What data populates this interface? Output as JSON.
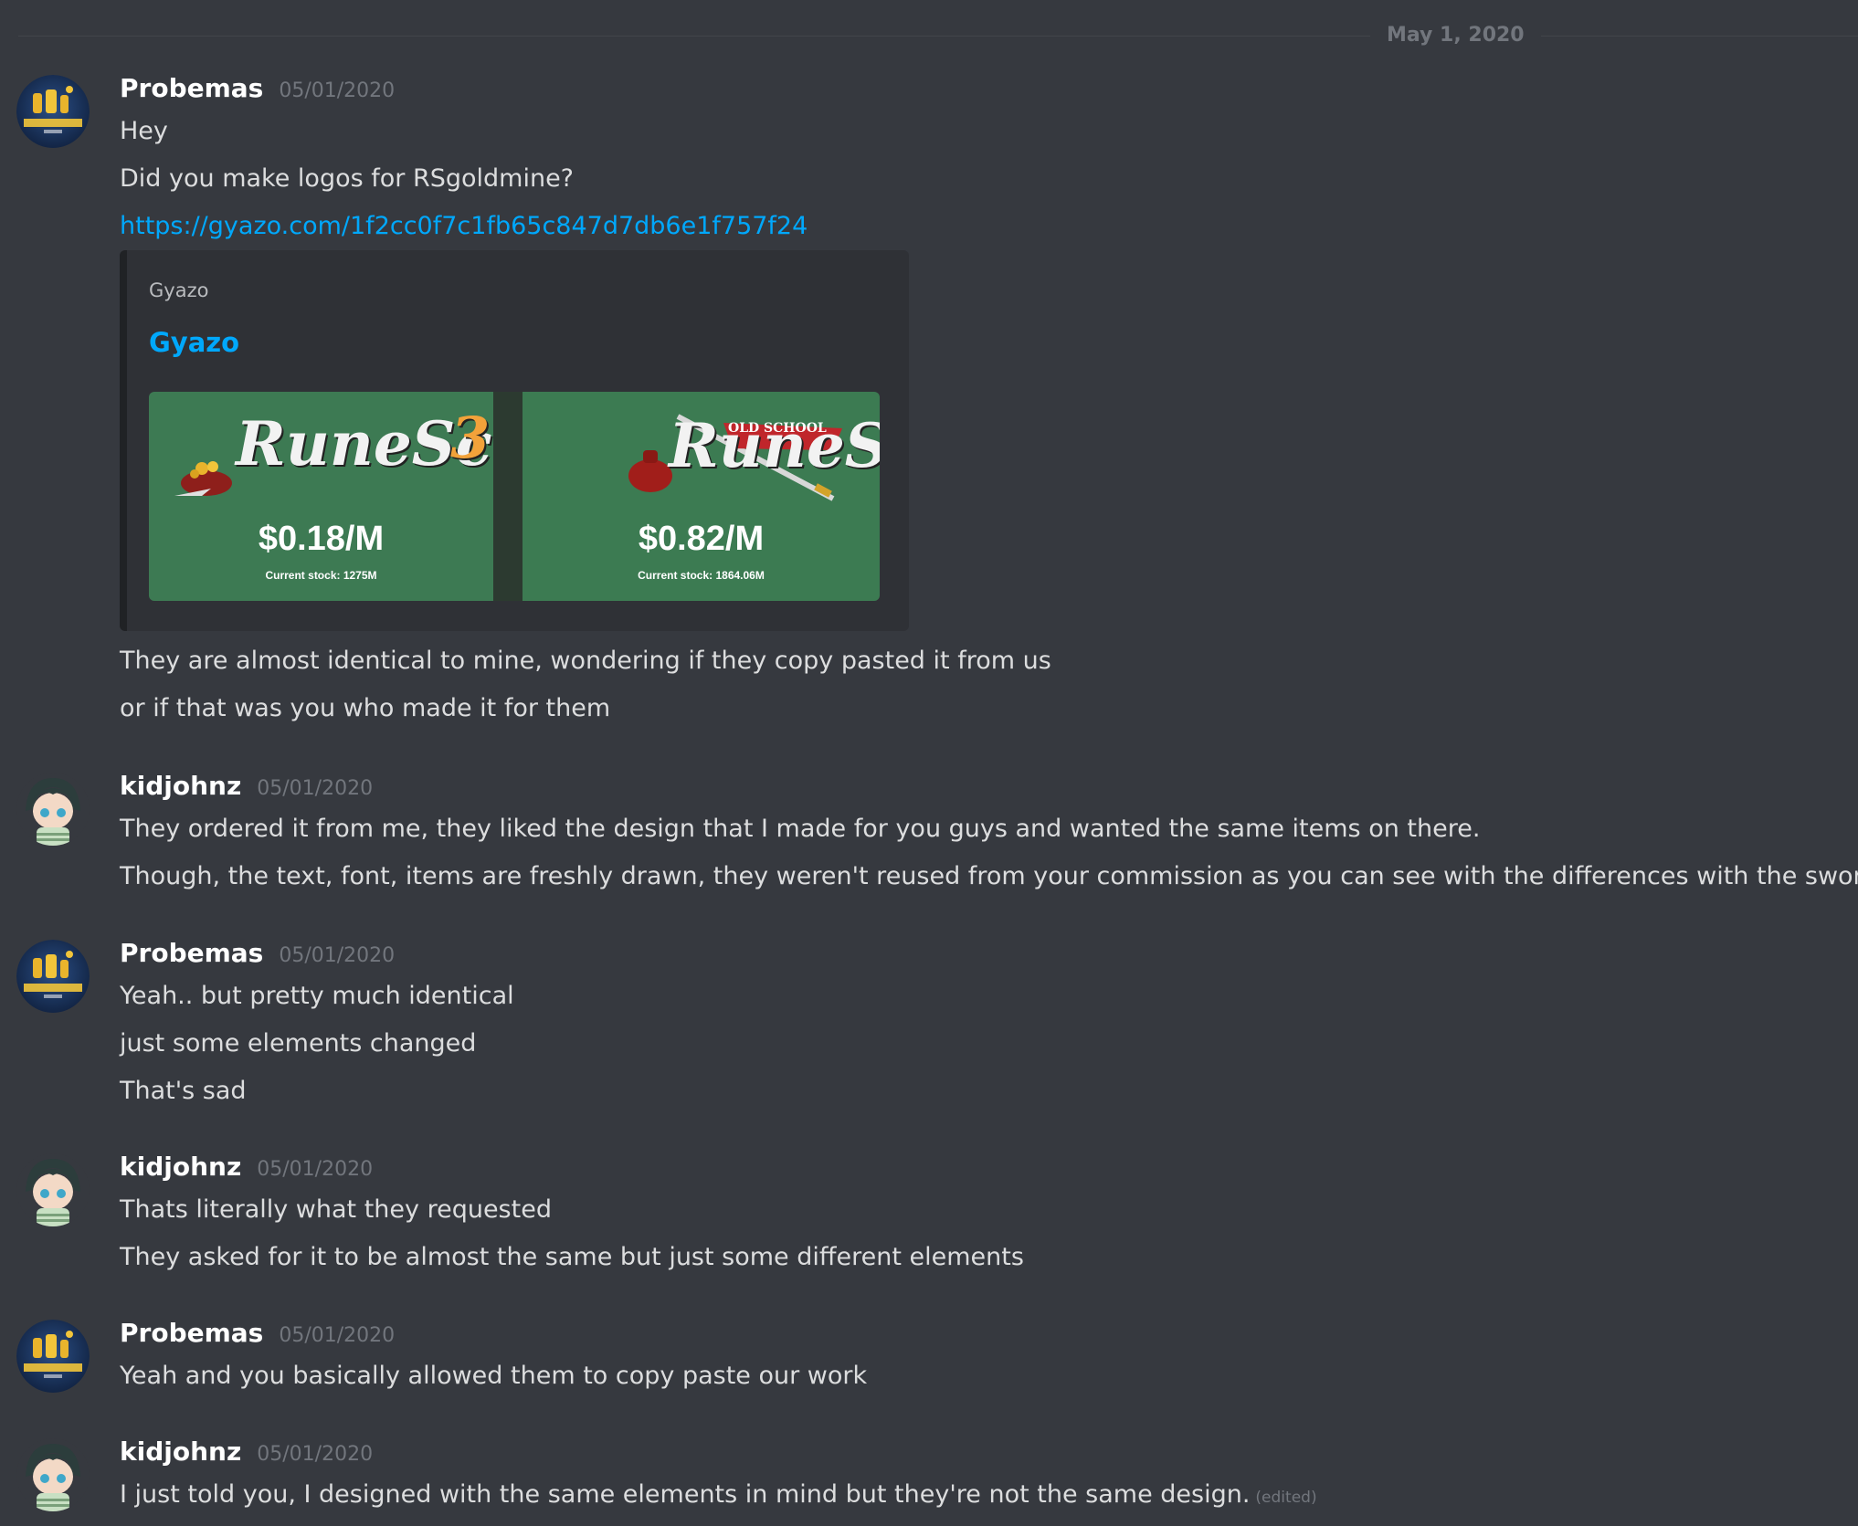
{
  "divider": {
    "date": "May 1, 2020"
  },
  "users": {
    "probemas": {
      "name": "Probemas",
      "avatar_icon": "probemas-logo-avatar",
      "avatar_color": "#1e3a66"
    },
    "kidjohnz": {
      "name": "kidjohnz",
      "avatar_icon": "anime-character-avatar",
      "avatar_color": "#cfe3d4"
    }
  },
  "colors": {
    "background": "#36393f",
    "link": "#00a8fc",
    "embed_bg": "#2f3136",
    "panel_green": "#3d7a53"
  },
  "messages": [
    {
      "author": "Probemas",
      "timestamp": "05/01/2020",
      "lines": [
        "Hey",
        "Did you make logos for RSgoldmine?",
        "https://gyazo.com/1f2cc0f7c1fb65c847d7db6e1f757f24"
      ],
      "embed": {
        "provider": "Gyazo",
        "title": "Gyazo",
        "left_panel": {
          "logo_text": "RuneScape",
          "logo_number": "3",
          "price": "$0.18/M",
          "stock": "Current stock: 1275M"
        },
        "right_panel": {
          "logo_banner": "OLD SCHOOL",
          "logo_text": "RuneScape",
          "price": "$0.82/M",
          "stock": "Current stock: 1864.06M"
        }
      },
      "after_lines": [
        "They are almost identical to mine, wondering if they copy pasted it from us",
        "or if that was you who made it for them"
      ]
    },
    {
      "author": "kidjohnz",
      "timestamp": "05/01/2020",
      "lines": [
        "They ordered it from me, they liked the design that I made for you guys and wanted the same items on there.",
        "Though, the text, font, items are freshly drawn, they weren't reused from your commission as you can see with the differences with the sword."
      ]
    },
    {
      "author": "Probemas",
      "timestamp": "05/01/2020",
      "lines": [
        "Yeah.. but pretty much identical",
        "just some elements changed",
        "That's sad"
      ]
    },
    {
      "author": "kidjohnz",
      "timestamp": "05/01/2020",
      "lines": [
        "Thats literally what they requested",
        "They asked for it to be almost the same but just some different elements"
      ]
    },
    {
      "author": "Probemas",
      "timestamp": "05/01/2020",
      "lines": [
        "Yeah and you basically allowed them to copy paste our work"
      ]
    },
    {
      "author": "kidjohnz",
      "timestamp": "05/01/2020",
      "lines": [
        "I just told you, I designed with the same elements in mind but they're not the same design."
      ],
      "edited_label": "(edited)"
    }
  ]
}
